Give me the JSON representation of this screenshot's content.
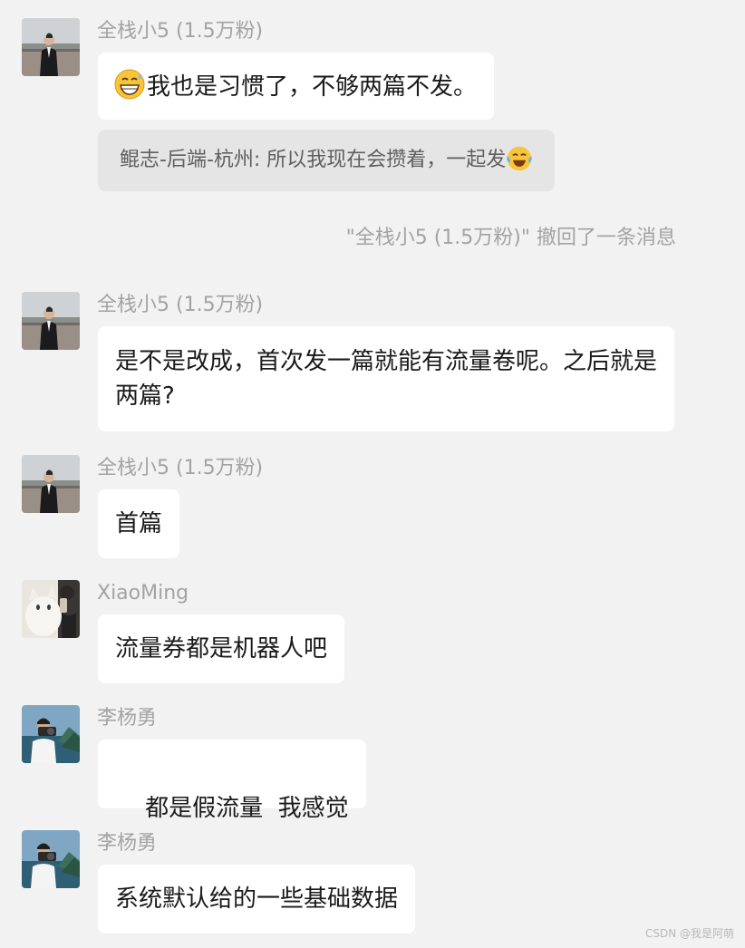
{
  "messages": [
    {
      "sender": "全栈小5 (1.5万粉)",
      "avatar": "avatar-man-suit",
      "text": "我也是习惯了，不够两篇不发。",
      "emoji_prefix": "grinning-sweat-emoji"
    },
    {
      "sender": "全栈小5 (1.5万粉)",
      "avatar": "avatar-man-suit",
      "text": "是不是改成，首次发一篇就能有流量卷呢。之后就是两篇?"
    },
    {
      "sender": "全栈小5 (1.5万粉)",
      "avatar": "avatar-man-suit",
      "text": "首篇"
    },
    {
      "sender": "XiaoMing",
      "avatar": "avatar-cat-selfie",
      "text": "流量券都是机器人吧"
    },
    {
      "sender": "李杨勇",
      "avatar": "avatar-photographer",
      "text": "都是假流量  我感觉"
    },
    {
      "sender": "李杨勇",
      "avatar": "avatar-photographer",
      "text": "系统默认给的一些基础数据"
    }
  ],
  "quote": {
    "text": "鲲志-后端-杭州: 所以我现在会攒着，一起发",
    "emoji_suffix": "tears-of-joy-emoji"
  },
  "system_notice": "\"全栈小5 (1.5万粉)\" 撤回了一条消息",
  "watermark": "CSDN @我是阿萌",
  "colors": {
    "background": "#f2f2f2",
    "bubble": "#ffffff",
    "quote_bg": "#e5e5e5",
    "muted_text": "#a3a3a3"
  }
}
